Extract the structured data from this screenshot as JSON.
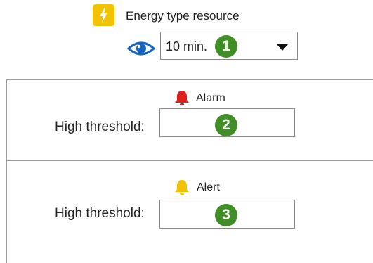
{
  "header": {
    "resource_title": "Energy type resource",
    "resource_icon": "lightning-icon",
    "accent_color": "#f2c200"
  },
  "refresh": {
    "icon": "eye-icon",
    "selected_value": "10 min.",
    "badge": "1"
  },
  "thresholds": [
    {
      "level": "Alarm",
      "icon": "bell-icon",
      "icon_color": "#e0201b",
      "field_label": "High threshold:",
      "value": "",
      "badge": "2"
    },
    {
      "level": "Alert",
      "icon": "bell-icon",
      "icon_color": "#f2c200",
      "field_label": "High threshold:",
      "value": "",
      "badge": "3"
    }
  ],
  "colors": {
    "badge": "#3f8f26",
    "eye": "#1565c0"
  }
}
